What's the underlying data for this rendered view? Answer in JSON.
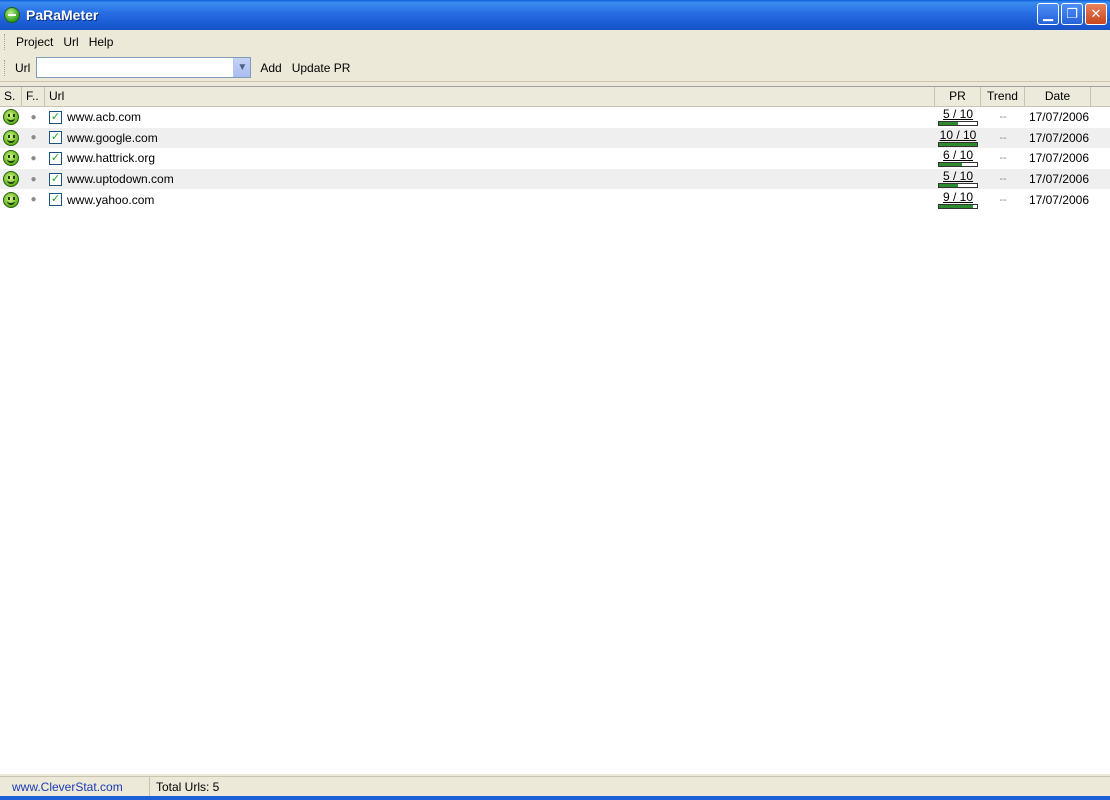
{
  "window": {
    "title": "PaRaMeter"
  },
  "menu": [
    "Project",
    "Url",
    "Help"
  ],
  "toolbar": {
    "url_label": "Url",
    "url_value": "",
    "add_label": "Add",
    "update_label": "Update PR"
  },
  "columns": {
    "status": "S.",
    "favicon": "F..",
    "url": "Url",
    "pr": "PR",
    "trend": "Trend",
    "date": "Date"
  },
  "rows": [
    {
      "url": "www.acb.com",
      "pr": "5 / 10",
      "pr_value": 5,
      "trend": "--",
      "date": "17/07/2006"
    },
    {
      "url": "www.google.com",
      "pr": "10 / 10",
      "pr_value": 10,
      "trend": "--",
      "date": "17/07/2006"
    },
    {
      "url": "www.hattrick.org",
      "pr": "6 / 10",
      "pr_value": 6,
      "trend": "--",
      "date": "17/07/2006"
    },
    {
      "url": "www.uptodown.com",
      "pr": "5 / 10",
      "pr_value": 5,
      "trend": "--",
      "date": "17/07/2006"
    },
    {
      "url": "www.yahoo.com",
      "pr": "9 / 10",
      "pr_value": 9,
      "trend": "--",
      "date": "17/07/2006"
    }
  ],
  "status": {
    "link": "www.CleverStat.com",
    "total": "Total Urls: 5"
  },
  "colors": {
    "titlebar": "#1d5fd6",
    "pr_fill": "#2e8a2e",
    "link": "#1a3bb8"
  }
}
